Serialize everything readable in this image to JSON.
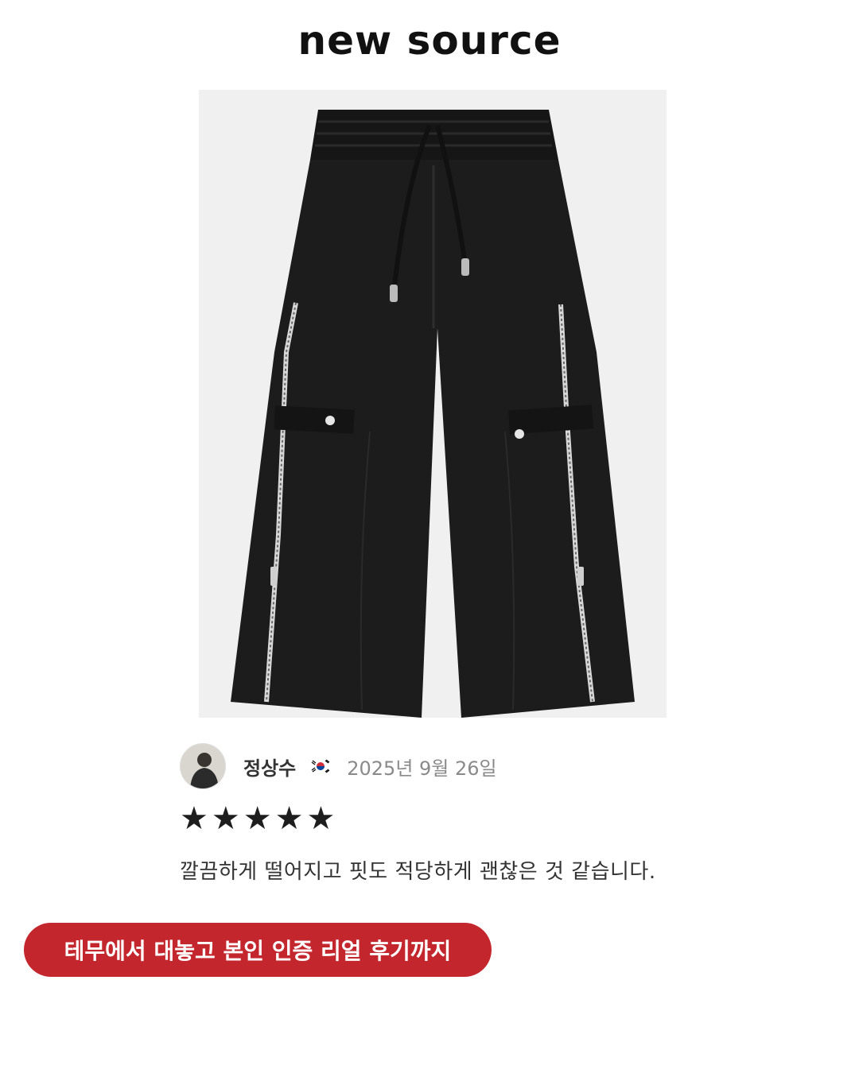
{
  "brand": {
    "logo_text": "new source"
  },
  "product": {
    "image_alt": "black wide-leg cargo pants with side zippers"
  },
  "review": {
    "reviewer_name": "정상수",
    "country_flag": "kr-flag-icon",
    "date": "2025년 9월 26일",
    "rating": 5,
    "rating_max": 5,
    "star_glyph": "★",
    "text": "깔끔하게 떨어지고 핏도 적당하게 괜찮은 것 같습니다."
  },
  "promo": {
    "label": "테무에서 대놓고 본인 인증 리얼 후기까지",
    "color": "#c4262d"
  }
}
